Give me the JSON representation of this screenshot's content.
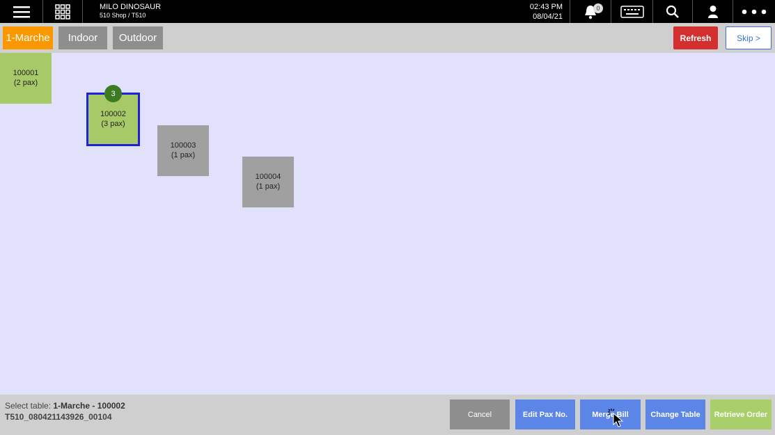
{
  "header": {
    "app_name": "MILO DINOSAUR",
    "shop_terminal": "510 Shop / T510",
    "time": "02:43 PM",
    "date": "08/04/21",
    "notification_count": "0",
    "icons": [
      "menu-icon",
      "grid-icon",
      "bell-icon",
      "keyboard-icon",
      "search-icon",
      "user-icon",
      "more-icon"
    ]
  },
  "tabs": [
    {
      "label": "1-Marche",
      "active": true
    },
    {
      "label": "Indoor",
      "active": false
    },
    {
      "label": "Outdoor",
      "active": false
    }
  ],
  "actions": {
    "refresh_label": "Refresh",
    "skip_label": "Skip >"
  },
  "tables": [
    {
      "id": "100001",
      "pax": "(2 pax)",
      "status": "occupied"
    },
    {
      "id": "100002",
      "pax": "(3 pax)",
      "status": "selected",
      "badge": "3"
    },
    {
      "id": "100003",
      "pax": "(1 pax)",
      "status": "available"
    },
    {
      "id": "100004",
      "pax": "(1 pax)",
      "status": "available"
    }
  ],
  "footer": {
    "select_prefix": "Select table: ",
    "select_value": "1-Marche - 100002",
    "order_code": "T510_080421143926_00104",
    "buttons": {
      "cancel": "Cancel",
      "edit_pax": "Edit Pax No.",
      "merge_bill": "Merge Bill",
      "change_table": "Change Table",
      "retrieve_order": "Retrieve Order"
    }
  },
  "colors": {
    "active_tab": "#fb9800",
    "refresh": "#d32f2f",
    "selected_border": "#1d22d8",
    "occupied_table": "#a8c968",
    "available_table": "#a0a0a0",
    "action_blue": "#5b86e8",
    "retrieve_green": "#a8cf6a",
    "canvas_bg": "#e2e1fb"
  }
}
